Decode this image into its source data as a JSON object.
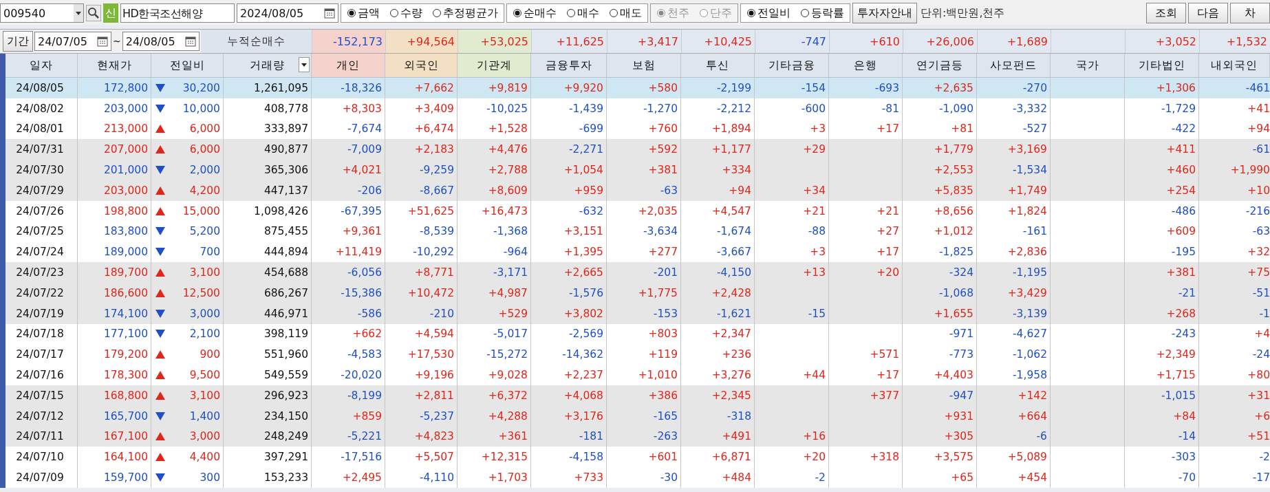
{
  "toolbar": {
    "code": "009540",
    "badge": "신",
    "name": "HD한국조선해양",
    "date": "2024/08/05",
    "radio_groups": [
      {
        "disabled": false,
        "options": [
          {
            "label": "금액",
            "selected": true
          },
          {
            "label": "수량",
            "selected": false
          },
          {
            "label": "추정평균가",
            "selected": false
          }
        ]
      },
      {
        "disabled": false,
        "options": [
          {
            "label": "순매수",
            "selected": true
          },
          {
            "label": "매수",
            "selected": false
          },
          {
            "label": "매도",
            "selected": false
          }
        ]
      },
      {
        "disabled": true,
        "options": [
          {
            "label": "천주",
            "selected": true
          },
          {
            "label": "단주",
            "selected": false
          }
        ]
      },
      {
        "disabled": false,
        "options": [
          {
            "label": "전일비",
            "selected": true
          },
          {
            "label": "등락률",
            "selected": false
          }
        ]
      }
    ],
    "guide_button": "투자자안내",
    "unit": "단위:백만원,천주",
    "buttons": [
      "조회",
      "다음",
      "차"
    ]
  },
  "period": {
    "button": "기간",
    "from": "24/07/05",
    "separator": "~",
    "to": "24/08/05",
    "label": "누적순매수"
  },
  "columns": [
    {
      "label": "일자"
    },
    {
      "label": "현재가"
    },
    {
      "label": "전일비"
    },
    {
      "label": "거래량",
      "sort_menu": true
    },
    {
      "label": "개인",
      "color": "#f6d2cd",
      "total": "-152,173"
    },
    {
      "label": "외국인",
      "color": "#f3e0c4",
      "total": "+94,564"
    },
    {
      "label": "기관계",
      "color": "#e0ebcf",
      "total": "+53,025"
    },
    {
      "label": "금융투자",
      "total": "+11,625"
    },
    {
      "label": "보험",
      "total": "+3,417"
    },
    {
      "label": "투신",
      "total": "+10,425"
    },
    {
      "label": "기타금융",
      "total": "-747"
    },
    {
      "label": "은행",
      "total": "+610"
    },
    {
      "label": "연기금등",
      "total": "+26,006"
    },
    {
      "label": "사모펀드",
      "total": "+1,689"
    },
    {
      "label": "국가"
    },
    {
      "label": "기타법인",
      "total": "+3,052"
    },
    {
      "label": "내외국인",
      "total": "+1,532"
    }
  ],
  "rows": [
    {
      "selected": true,
      "shaded": false,
      "date": "24/08/05",
      "price": "172,800",
      "rising": false,
      "change": "30,200",
      "volume": "1,261,095",
      "values": {
        "column_5": "-18,326",
        "column_6": "+7,662",
        "column_7": "+9,819",
        "column_8": "+9,920",
        "column_9": "+580",
        "column_10": "-2,199",
        "column_11": "-154",
        "column_12": "-693",
        "column_13": "+2,635",
        "column_14": "-270",
        "column_16": "+1,306",
        "column_17": "-461"
      }
    },
    {
      "selected": false,
      "shaded": false,
      "date": "24/08/02",
      "price": "203,000",
      "rising": false,
      "change": "10,000",
      "volume": "408,778",
      "values": {
        "column_5": "+8,303",
        "column_6": "+3,409",
        "column_7": "-10,025",
        "column_8": "-1,439",
        "column_9": "-1,270",
        "column_10": "-2,212",
        "column_11": "-600",
        "column_12": "-81",
        "column_13": "-1,090",
        "column_14": "-3,332",
        "column_16": "-1,729",
        "column_17": "+41"
      }
    },
    {
      "selected": false,
      "shaded": false,
      "date": "24/08/01",
      "price": "213,000",
      "rising": true,
      "change": "6,000",
      "volume": "333,897",
      "values": {
        "column_5": "-7,674",
        "column_6": "+6,474",
        "column_7": "+1,528",
        "column_8": "-699",
        "column_9": "+760",
        "column_10": "+1,894",
        "column_11": "+3",
        "column_12": "+17",
        "column_13": "+81",
        "column_14": "-527",
        "column_16": "-422",
        "column_17": "+94"
      }
    },
    {
      "selected": false,
      "shaded": true,
      "date": "24/07/31",
      "price": "207,000",
      "rising": true,
      "change": "6,000",
      "volume": "490,877",
      "values": {
        "column_5": "-7,009",
        "column_6": "+2,183",
        "column_7": "+4,476",
        "column_8": "-2,271",
        "column_9": "+592",
        "column_10": "+1,177",
        "column_11": "+29",
        "column_13": "+1,779",
        "column_14": "+3,169",
        "column_16": "+411",
        "column_17": "-61"
      }
    },
    {
      "selected": false,
      "shaded": true,
      "date": "24/07/30",
      "price": "201,000",
      "rising": false,
      "change": "2,000",
      "volume": "365,306",
      "values": {
        "column_5": "+4,021",
        "column_6": "-9,259",
        "column_7": "+2,788",
        "column_8": "+1,054",
        "column_9": "+381",
        "column_10": "+334",
        "column_13": "+2,553",
        "column_14": "-1,534",
        "column_16": "+460",
        "column_17": "+1,990"
      }
    },
    {
      "selected": false,
      "shaded": true,
      "date": "24/07/29",
      "price": "203,000",
      "rising": true,
      "change": "4,200",
      "volume": "447,137",
      "values": {
        "column_5": "-206",
        "column_6": "-8,667",
        "column_7": "+8,609",
        "column_8": "+959",
        "column_9": "-63",
        "column_10": "+94",
        "column_11": "+34",
        "column_13": "+5,835",
        "column_14": "+1,749",
        "column_16": "+254",
        "column_17": "+10"
      }
    },
    {
      "selected": false,
      "shaded": false,
      "date": "24/07/26",
      "price": "198,800",
      "rising": true,
      "change": "15,000",
      "volume": "1,098,426",
      "values": {
        "column_5": "-67,395",
        "column_6": "+51,625",
        "column_7": "+16,473",
        "column_8": "-632",
        "column_9": "+2,035",
        "column_10": "+4,547",
        "column_11": "+21",
        "column_12": "+21",
        "column_13": "+8,656",
        "column_14": "+1,824",
        "column_16": "-486",
        "column_17": "-216"
      }
    },
    {
      "selected": false,
      "shaded": false,
      "date": "24/07/25",
      "price": "183,800",
      "rising": false,
      "change": "5,200",
      "volume": "875,455",
      "values": {
        "column_5": "+9,361",
        "column_6": "-8,539",
        "column_7": "-1,368",
        "column_8": "+3,151",
        "column_9": "-3,634",
        "column_10": "-1,674",
        "column_11": "-88",
        "column_12": "+27",
        "column_13": "+1,012",
        "column_14": "-161",
        "column_16": "+609",
        "column_17": "-63"
      }
    },
    {
      "selected": false,
      "shaded": false,
      "date": "24/07/24",
      "price": "189,000",
      "rising": false,
      "change": "700",
      "volume": "444,894",
      "values": {
        "column_5": "+11,419",
        "column_6": "-10,292",
        "column_7": "-964",
        "column_8": "+1,395",
        "column_9": "+277",
        "column_10": "-3,667",
        "column_11": "+3",
        "column_12": "+17",
        "column_13": "-1,825",
        "column_14": "+2,836",
        "column_16": "-195",
        "column_17": "+32"
      }
    },
    {
      "selected": false,
      "shaded": true,
      "date": "24/07/23",
      "price": "189,700",
      "rising": true,
      "change": "3,100",
      "volume": "454,688",
      "values": {
        "column_5": "-6,056",
        "column_6": "+8,771",
        "column_7": "-3,171",
        "column_8": "+2,665",
        "column_9": "-201",
        "column_10": "-4,150",
        "column_11": "+13",
        "column_12": "+20",
        "column_13": "-324",
        "column_14": "-1,195",
        "column_16": "+381",
        "column_17": "+75"
      }
    },
    {
      "selected": false,
      "shaded": true,
      "date": "24/07/22",
      "price": "186,600",
      "rising": true,
      "change": "12,500",
      "volume": "686,267",
      "values": {
        "column_5": "-15,386",
        "column_6": "+10,472",
        "column_7": "+4,987",
        "column_8": "-1,576",
        "column_9": "+1,775",
        "column_10": "+2,428",
        "column_13": "-1,068",
        "column_14": "+3,429",
        "column_16": "-21",
        "column_17": "-51"
      }
    },
    {
      "selected": false,
      "shaded": true,
      "date": "24/07/19",
      "price": "174,100",
      "rising": false,
      "change": "3,000",
      "volume": "446,971",
      "values": {
        "column_5": "-586",
        "column_6": "-210",
        "column_7": "+529",
        "column_8": "+3,802",
        "column_9": "-153",
        "column_10": "-1,621",
        "column_11": "-15",
        "column_13": "+1,655",
        "column_14": "-3,139",
        "column_16": "+268",
        "column_17": "-1"
      }
    },
    {
      "selected": false,
      "shaded": false,
      "date": "24/07/18",
      "price": "177,100",
      "rising": false,
      "change": "2,100",
      "volume": "398,119",
      "values": {
        "column_5": "+662",
        "column_6": "+4,594",
        "column_7": "-5,017",
        "column_8": "-2,569",
        "column_9": "+803",
        "column_10": "+2,347",
        "column_13": "-971",
        "column_14": "-4,627",
        "column_16": "-243",
        "column_17": "+4"
      }
    },
    {
      "selected": false,
      "shaded": false,
      "date": "24/07/17",
      "price": "179,200",
      "rising": true,
      "change": "900",
      "volume": "551,960",
      "values": {
        "column_5": "-4,583",
        "column_6": "+17,530",
        "column_7": "-15,272",
        "column_8": "-14,362",
        "column_9": "+119",
        "column_10": "+236",
        "column_12": "+571",
        "column_13": "-773",
        "column_14": "-1,062",
        "column_16": "+2,349",
        "column_17": "-24"
      }
    },
    {
      "selected": false,
      "shaded": false,
      "date": "24/07/16",
      "price": "178,300",
      "rising": true,
      "change": "9,500",
      "volume": "549,559",
      "values": {
        "column_5": "-20,020",
        "column_6": "+9,196",
        "column_7": "+9,028",
        "column_8": "+2,237",
        "column_9": "+1,010",
        "column_10": "+3,276",
        "column_11": "+44",
        "column_12": "+17",
        "column_13": "+4,403",
        "column_14": "-1,958",
        "column_16": "+1,715",
        "column_17": "+80"
      }
    },
    {
      "selected": false,
      "shaded": true,
      "date": "24/07/15",
      "price": "168,800",
      "rising": true,
      "change": "3,100",
      "volume": "296,923",
      "values": {
        "column_5": "-8,199",
        "column_6": "+2,811",
        "column_7": "+6,372",
        "column_8": "+4,068",
        "column_9": "+386",
        "column_10": "+2,345",
        "column_12": "+377",
        "column_13": "-947",
        "column_14": "+142",
        "column_16": "-1,015",
        "column_17": "+31"
      }
    },
    {
      "selected": false,
      "shaded": true,
      "date": "24/07/12",
      "price": "165,700",
      "rising": false,
      "change": "1,400",
      "volume": "234,150",
      "values": {
        "column_5": "+859",
        "column_6": "-5,237",
        "column_7": "+4,288",
        "column_8": "+3,176",
        "column_9": "-165",
        "column_10": "-318",
        "column_13": "+931",
        "column_14": "+664",
        "column_16": "+84",
        "column_17": "+6"
      }
    },
    {
      "selected": false,
      "shaded": true,
      "date": "24/07/11",
      "price": "167,100",
      "rising": true,
      "change": "3,000",
      "volume": "248,249",
      "values": {
        "column_5": "-5,221",
        "column_6": "+4,823",
        "column_7": "+361",
        "column_8": "-181",
        "column_9": "-263",
        "column_10": "+491",
        "column_11": "+16",
        "column_13": "+305",
        "column_14": "-6",
        "column_16": "-14",
        "column_17": "+51"
      }
    },
    {
      "selected": false,
      "shaded": false,
      "date": "24/07/10",
      "price": "164,100",
      "rising": true,
      "change": "4,400",
      "volume": "397,291",
      "values": {
        "column_5": "-17,516",
        "column_6": "+5,507",
        "column_7": "+12,315",
        "column_8": "-4,158",
        "column_9": "+601",
        "column_10": "+6,871",
        "column_11": "+20",
        "column_12": "+318",
        "column_13": "+3,575",
        "column_14": "+5,089",
        "column_16": "-303",
        "column_17": "-2"
      }
    },
    {
      "selected": false,
      "shaded": false,
      "date": "24/07/09",
      "price": "159,700",
      "rising": false,
      "change": "300",
      "volume": "153,233",
      "values": {
        "column_5": "+2,495",
        "column_6": "-4,110",
        "column_7": "+1,703",
        "column_8": "+733",
        "column_9": "-30",
        "column_10": "+484",
        "column_11": "-2",
        "column_13": "+65",
        "column_14": "+454",
        "column_16": "-70",
        "column_17": "-17"
      }
    }
  ]
}
